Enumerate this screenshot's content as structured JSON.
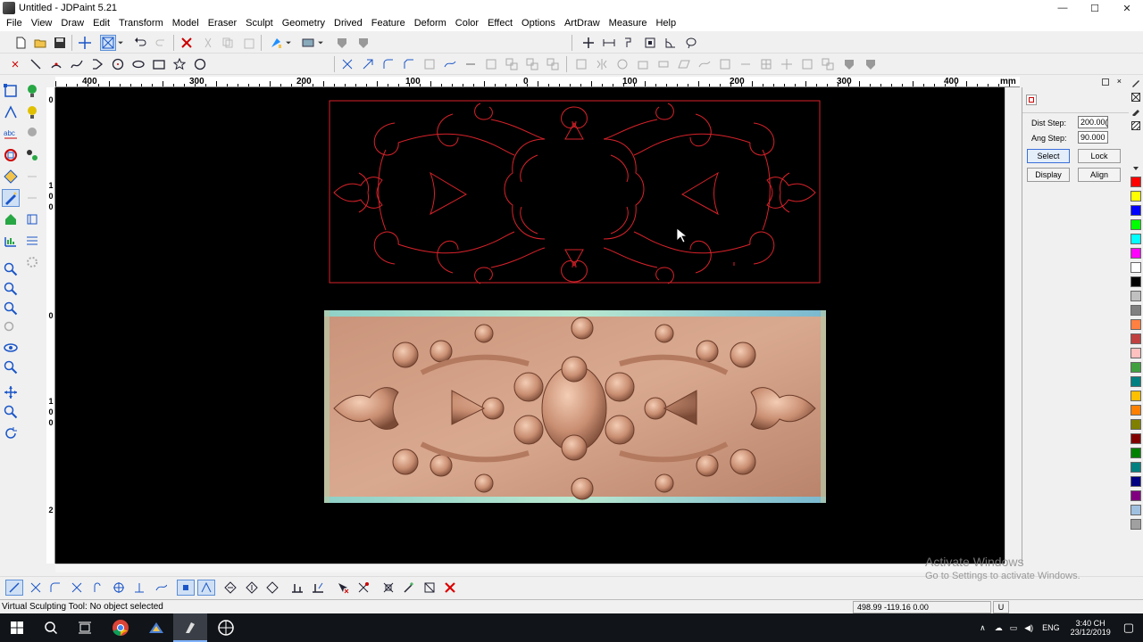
{
  "window": {
    "title": "Untitled - JDPaint 5.21",
    "minimize": "—",
    "maximize": "☐",
    "close": "✕"
  },
  "menu": [
    "File",
    "View",
    "Draw",
    "Edit",
    "Transform",
    "Model",
    "Eraser",
    "Sculpt",
    "Geometry",
    "Drived",
    "Feature",
    "Deform",
    "Color",
    "Effect",
    "Options",
    "ArtDraw",
    "Measure",
    "Help"
  ],
  "ruler_top": {
    "labels": [
      "400",
      "300",
      "200",
      "100",
      "0",
      "100",
      "200",
      "300",
      "400"
    ],
    "unit": "mm"
  },
  "ruler_left": {
    "labels": [
      "0",
      "1",
      "0",
      "0",
      "0",
      "1",
      "0",
      "0",
      "2"
    ]
  },
  "panel": {
    "dist_step_label": "Dist Step:",
    "dist_step_value": "200.00(",
    "ang_step_label": "Ang Step:",
    "ang_step_value": "90.000",
    "select_label": "Select",
    "lock_label": "Lock",
    "display_label": "Display",
    "align_label": "Align"
  },
  "palette": [
    "#ff0000",
    "#ffff00",
    "#0000ff",
    "#00ff00",
    "#00ffff",
    "#ff00ff",
    "#ffffff",
    "#000000",
    "#c0c0c0",
    "#808080",
    "#ff8040",
    "#c04040",
    "#ffc0c0",
    "#40a040",
    "#008080",
    "#ffc000",
    "#ff8000",
    "#808000",
    "#800000",
    "#008000",
    "#008080",
    "#000080",
    "#800080",
    "#a0c0e0",
    "#a0a0a0"
  ],
  "status": {
    "text": "Virtual Sculpting Tool: No object selected",
    "coords": "498.99 -119.16 0.00",
    "unit_flag": "U"
  },
  "watermark": {
    "line1": "Activate Windows",
    "line2": "Go to Settings to activate Windows."
  },
  "taskbar": {
    "lang": "ENG",
    "time": "3:40 CH",
    "date": "23/12/2019"
  }
}
